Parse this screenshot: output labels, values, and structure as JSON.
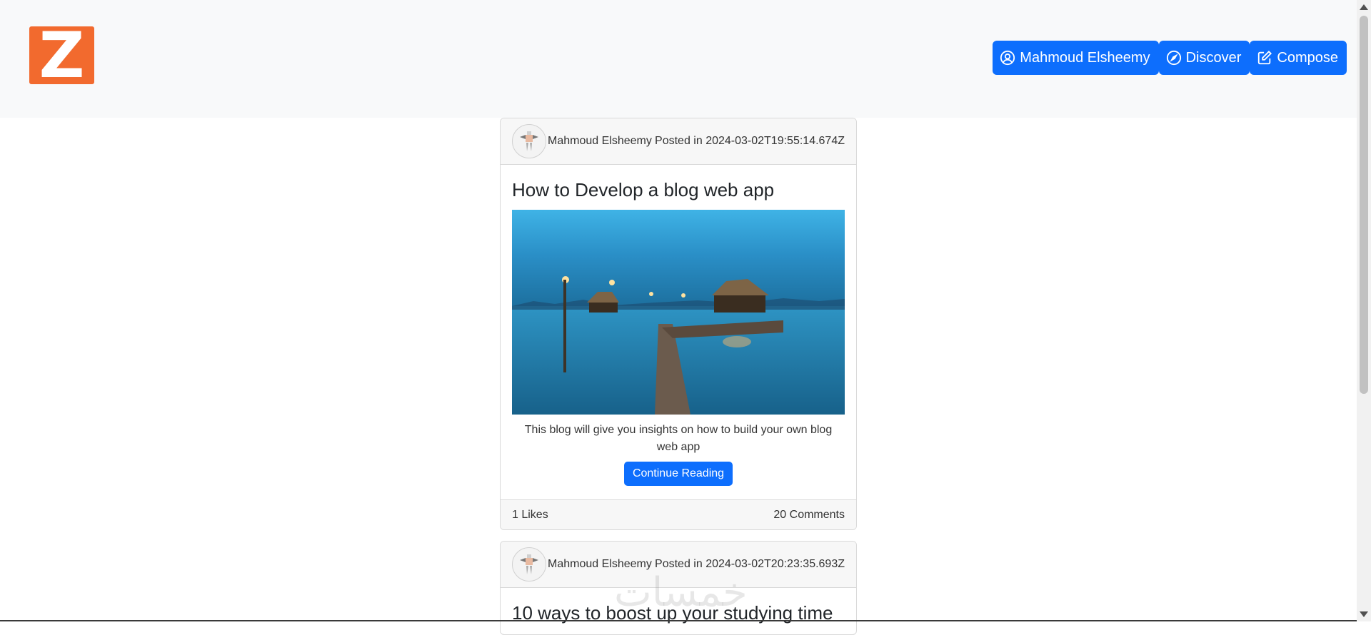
{
  "nav": {
    "logo_letter": "Z",
    "buttons": [
      {
        "label": "Mahmoud Elsheemy",
        "icon": "user-circle-icon"
      },
      {
        "label": "Discover",
        "icon": "compass-icon"
      },
      {
        "label": "Compose",
        "icon": "pencil-square-icon"
      }
    ]
  },
  "posts": [
    {
      "author": "Mahmoud Elsheemy",
      "posted": "Posted in 2024-03-02T19:55:14.674Z",
      "title": "How to Develop a blog web app",
      "description": "This blog will give you insights on how to build your own blog web app",
      "button": "Continue Reading",
      "likes": "1 Likes",
      "comments": "20 Comments"
    },
    {
      "author": "Mahmoud Elsheemy",
      "posted": "Posted in 2024-03-02T20:23:35.693Z",
      "title": "10 ways to boost up your studying time"
    }
  ],
  "watermark": "خمسات",
  "colors": {
    "primary": "#0d6efd",
    "logo": "#f26a2e",
    "navbar_bg": "#f8f9fa"
  }
}
